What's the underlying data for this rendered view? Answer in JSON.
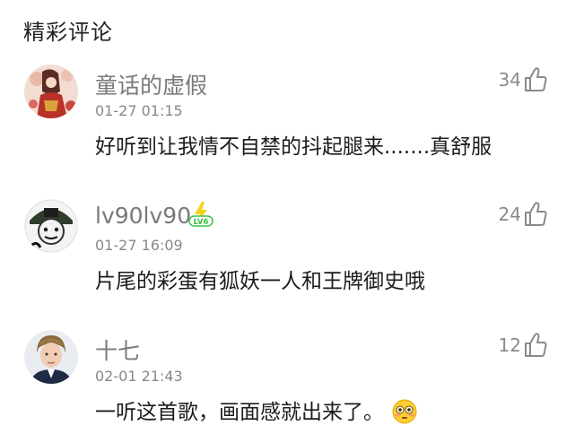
{
  "section_title": "精彩评论",
  "comments": [
    {
      "username": "童话的虚假",
      "timestamp": "01-27 01:15",
      "content": "好听到让我情不自禁的抖起腿来.......真舒服",
      "likes": "34"
    },
    {
      "username": "lv90lv90",
      "badge": "LV6",
      "timestamp": "01-27 16:09",
      "content": "片尾的彩蛋有狐妖一人和王牌御史哦",
      "likes": "24"
    },
    {
      "username": "十七",
      "timestamp": "02-01 21:43",
      "content": "一听这首歌，画面感就出来了。",
      "likes": "12"
    }
  ],
  "icons": {
    "like": "thumbs-up-icon",
    "badge": "vip-level-badge-icon",
    "emoji": "flushed-face-emoji-icon"
  },
  "colors": {
    "badge_green": "#3cc24a",
    "badge_yellow": "#f5d31c"
  }
}
